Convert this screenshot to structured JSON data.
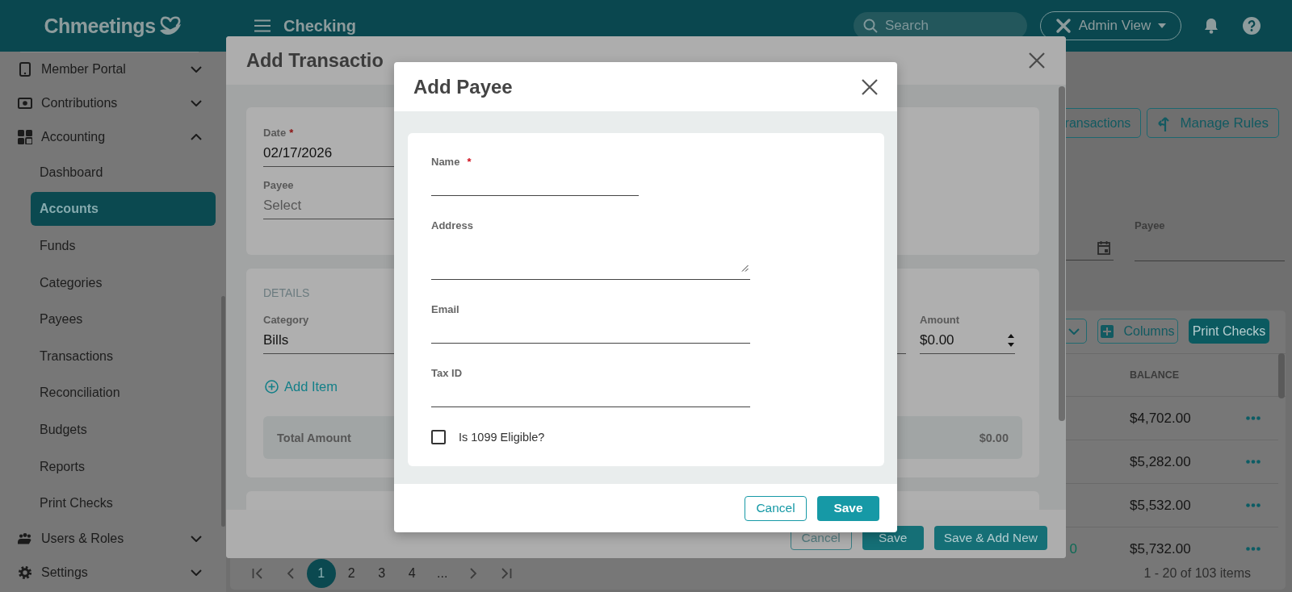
{
  "app_header": {
    "logo": "Chmeetings",
    "page_title": "Checking",
    "search": {
      "placeholder": "Search"
    },
    "view_switch": "Admin View"
  },
  "sidebar": {
    "items": [
      {
        "label": "Member Portal",
        "expanded": false
      },
      {
        "label": "Contributions",
        "expanded": false
      },
      {
        "label": "Accounting",
        "expanded": true,
        "children": [
          {
            "label": "Dashboard",
            "selected": false
          },
          {
            "label": "Accounts",
            "selected": true
          },
          {
            "label": "Funds",
            "selected": false
          },
          {
            "label": "Categories",
            "selected": false
          },
          {
            "label": "Payees",
            "selected": false
          },
          {
            "label": "Transactions",
            "selected": false
          },
          {
            "label": "Reconciliation",
            "selected": false
          },
          {
            "label": "Budgets",
            "selected": false
          },
          {
            "label": "Reports",
            "selected": false
          },
          {
            "label": "Print Checks",
            "selected": false
          }
        ]
      },
      {
        "label": "Users & Roles",
        "expanded": false
      },
      {
        "label": "Settings",
        "expanded": false
      }
    ]
  },
  "page": {
    "actions": [
      {
        "label": "ransactions",
        "kind": "plain"
      },
      {
        "label": "Manage Rules",
        "kind": "rules"
      }
    ],
    "filter": {
      "label": "Payee"
    },
    "table": {
      "tools": [
        {
          "label": "Columns",
          "kind": "outline"
        },
        {
          "label": "Print Checks",
          "kind": "filled"
        }
      ],
      "columns": [
        "BALANCE"
      ],
      "rows": [
        {
          "balance": "$4,702.00"
        },
        {
          "balance": "$5,282.00"
        },
        {
          "balance": "$5,532.00"
        },
        {
          "column_1": "0",
          "balance": "$5,732.00"
        }
      ],
      "pagination": {
        "pages": [
          {
            "label": "1",
            "selected": true
          },
          {
            "label": "2",
            "selected": false
          },
          {
            "label": "3",
            "selected": false
          },
          {
            "label": "4",
            "selected": false
          },
          {
            "label": "...",
            "selected": false
          }
        ]
      },
      "summary": "1 - 20 of 103 items"
    }
  },
  "transaction_modal": {
    "title": "Add Transactio",
    "fields": [
      {
        "label": "Date",
        "required_mark": "*",
        "value": "02/17/2026"
      },
      {
        "label": "Payee",
        "placeholder": "Select"
      }
    ],
    "details": {
      "heading": "DETAILS",
      "category": {
        "label": "Category",
        "value": "Bills"
      },
      "amount": {
        "label": "Amount",
        "value": "$0.00"
      },
      "add_item": "Add Item",
      "total": {
        "label": "Total Amount",
        "value": "$0.00"
      }
    },
    "buttons": [
      {
        "label": "Cancel",
        "kind": "outline"
      },
      {
        "label": "Save",
        "kind": "filled"
      },
      {
        "label": "Save & Add New",
        "kind": "filled"
      }
    ]
  },
  "payee_modal": {
    "title": "Add Payee",
    "fields": [
      {
        "label": "Name",
        "required_mark": "*",
        "kind": "short"
      },
      {
        "label": "Address",
        "kind": "multiline"
      },
      {
        "label": "Email",
        "kind": "line"
      },
      {
        "label": "Tax ID",
        "kind": "line"
      }
    ],
    "checkbox": {
      "label": "Is 1099 Eligible?",
      "checked": false
    },
    "buttons": [
      {
        "label": "Cancel",
        "kind": "outline"
      },
      {
        "label": "Save",
        "kind": "filled"
      }
    ]
  }
}
